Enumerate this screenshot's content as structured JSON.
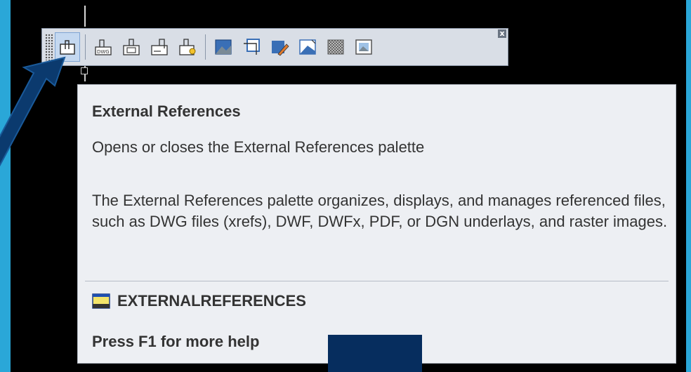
{
  "toolbar": {
    "buttons": [
      {
        "icon": "xref-palette-icon",
        "active": true
      },
      {
        "icon": "attach-dwg-icon"
      },
      {
        "icon": "attach-reference-icon"
      },
      {
        "icon": "clip-reference-icon"
      },
      {
        "icon": "reference-settings-icon"
      },
      {
        "icon": "image-attach-icon"
      },
      {
        "icon": "image-clip-icon"
      },
      {
        "icon": "image-adjust-icon"
      },
      {
        "icon": "image-quality-icon"
      },
      {
        "icon": "image-transparency-icon"
      },
      {
        "icon": "image-frame-icon"
      }
    ],
    "close_label": "x"
  },
  "tooltip": {
    "title": "External References",
    "description": "Opens or closes the External References palette",
    "body": "The External References palette organizes, displays, and manages referenced files, such as DWG files (xrefs), DWF, DWFx, PDF, or DGN underlays, and raster images.",
    "command": "EXTERNALREFERENCES",
    "help": "Press F1 for more help"
  },
  "colors": {
    "slide_background": "#2aa7d8",
    "canvas": "#000000",
    "arrow": "#0b3a6e",
    "tooltip_bg": "#edeff3"
  }
}
